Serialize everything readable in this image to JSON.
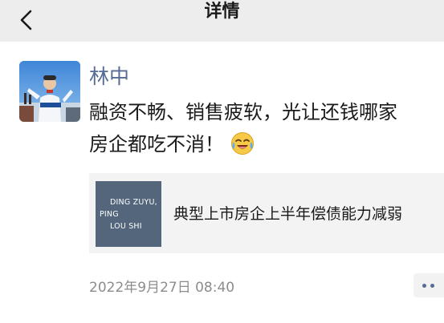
{
  "header": {
    "title": "详情",
    "back_icon": "chevron-left-icon"
  },
  "post": {
    "author": "林中",
    "text_line1": "融资不畅、销售疲软，光让还钱哪家",
    "text_line2": "房企都吃不消！",
    "emoji": "laughing-crying-emoji-icon",
    "link": {
      "thumb_line1": "DING ZUYU,",
      "thumb_line2": "PING",
      "thumb_line3": "LOU SHI",
      "title": "典型上市房企上半年偿债能力减弱"
    },
    "timestamp": "2022年9月27日 08:40",
    "more_icon": "more-dots-icon"
  },
  "colors": {
    "header_bg": "#ededed",
    "name_color": "#576b95",
    "card_bg": "#f3f3f3",
    "thumb_bg": "#53667c",
    "time_color": "#8c8c8c"
  }
}
